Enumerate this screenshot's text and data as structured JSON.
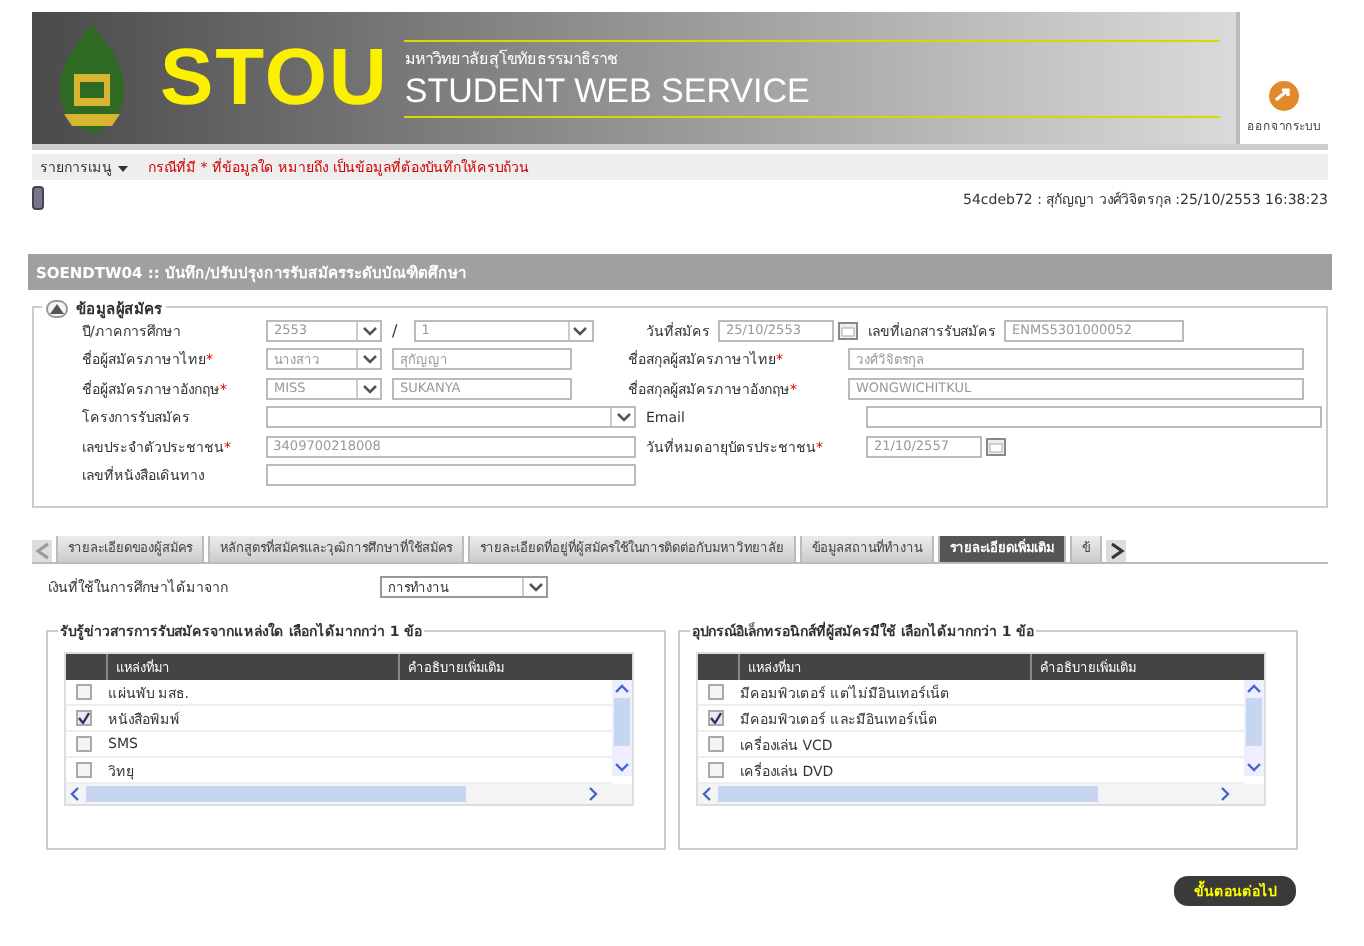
{
  "header": {
    "brand": "STOU",
    "university": "มหาวิทยาลัยสุโขทัยธรรมาธิราช",
    "service": "STUDENT WEB SERVICE",
    "logout": "ออกจากระบบ"
  },
  "menu_bar": {
    "menu": "รายการเมนู",
    "notice": "กรณีที่มี * ที่ข้อมูลใด หมายถึง เป็นข้อมูลที่ต้องบันทึกให้ครบถ้วน"
  },
  "status": "54cdeb72 : สุกัญญา วงศ์วิจิตรกุล :25/10/2553 16:38:23",
  "page_title": "SOENDTW04 :: บันทึก/ปรับปรุงการรับสมัครระดับบัณฑิตศึกษา",
  "section": {
    "title": "ข้อมูลผู้สมัคร",
    "expanded": true,
    "rows": [
      {
        "left": {
          "label": "ปี/ภาคการศึกษา",
          "controls": [
            {
              "kind": "select",
              "value": "2553",
              "disabled": true
            },
            {
              "kind": "sep",
              "value": "/"
            },
            {
              "kind": "select",
              "value": "1",
              "disabled": true
            }
          ]
        },
        "right": {
          "label": "วันที่สมัคร",
          "controls": [
            {
              "kind": "date",
              "value": "25/10/2553",
              "disabled": true
            },
            {
              "kind": "label",
              "value": "เลขที่เอกสารรับสมัคร"
            },
            {
              "kind": "text",
              "value": "ENMS5301000052",
              "disabled": true
            }
          ]
        }
      },
      {
        "left": {
          "label": "ชื่อผู้สมัครภาษาไทย",
          "mark": "*",
          "controls": [
            {
              "kind": "select",
              "value": "นางสาว",
              "disabled": true
            },
            {
              "kind": "text",
              "value": "สุกัญญา",
              "disabled": true
            }
          ]
        },
        "right": {
          "label": "ชื่อสกุลผู้สมัครภาษาไทย",
          "mark": "*",
          "controls": [
            {
              "kind": "text",
              "value": "วงศ์วิจิตรกุล",
              "disabled": true
            }
          ]
        }
      },
      {
        "left": {
          "label": "ชื่อผู้สมัครภาษาอังกฤษ",
          "mark": "*",
          "controls": [
            {
              "kind": "select",
              "value": "MISS",
              "disabled": true
            },
            {
              "kind": "text",
              "value": "SUKANYA",
              "disabled": true
            }
          ]
        },
        "right": {
          "label": "ชื่อสกุลผู้สมัครภาษาอังกฤษ",
          "mark": "*",
          "controls": [
            {
              "kind": "text",
              "value": "WONGWICHITKUL",
              "disabled": true
            }
          ]
        }
      },
      {
        "left": {
          "label": "โครงการรับสมัคร",
          "controls": [
            {
              "kind": "select"
            }
          ]
        },
        "right": {
          "label": "Email",
          "controls": [
            {
              "kind": "text"
            }
          ]
        }
      },
      {
        "left": {
          "label": "เลขประจำตัวประชาชน",
          "mark": "*",
          "controls": [
            {
              "kind": "text",
              "value": "3409700218008",
              "disabled": true
            }
          ]
        },
        "right": {
          "label": "วันที่หมดอายุบัตรประชาชน",
          "mark": "*",
          "controls": [
            {
              "kind": "date",
              "value": "21/10/2557",
              "disabled": true
            }
          ]
        }
      },
      {
        "left": {
          "label": "เลขที่หนังสือเดินทาง",
          "controls": [
            {
              "kind": "text"
            }
          ]
        }
      }
    ]
  },
  "tabs": [
    {
      "label": "รายละเอียดของผู้สมัคร",
      "selected": false
    },
    {
      "label": "หลักสูตรที่สมัครและวุฒิการศึกษาที่ใช้สมัคร",
      "selected": false
    },
    {
      "label": "รายละเอียดที่อยู่ที่ผู้สมัครใช้ในการติดต่อกับมหาวิทยาลัย",
      "selected": false
    },
    {
      "label": "ข้อมูลสถานที่ทำงาน",
      "selected": false
    },
    {
      "label": "รายละเอียดเพิ่มเติม",
      "selected": true
    },
    {
      "label": "ข้",
      "selected": false
    }
  ],
  "funding": {
    "label": "เงินที่ใช้ในการศึกษาได้มาจาก",
    "value": "การทำงาน"
  },
  "groups": [
    {
      "title": "รับรู้ข่าวสารการรับสมัครจากแหล่งใด เลือกได้มากกว่า 1 ข้อ",
      "columns": [
        "แหล่งที่มา",
        "คำอธิบายเพิ่มเติม"
      ],
      "rows": [
        {
          "label": "แผ่นพับ มสธ.",
          "checked": false
        },
        {
          "label": "หนังสือพิมพ์",
          "checked": true
        },
        {
          "label": "SMS",
          "checked": false
        },
        {
          "label": "วิทยุ",
          "checked": false
        }
      ]
    },
    {
      "title": "อุปกรณ์อิเล็กทรอนิกส์ที่ผู้สมัครมีใช้ เลือกได้มากกว่า 1 ข้อ",
      "columns": [
        "แหล่งที่มา",
        "คำอธิบายเพิ่มเติม"
      ],
      "rows": [
        {
          "label": "มีคอมพิวเตอร์ แต่ไม่มีอินเทอร์เน็ต",
          "checked": false
        },
        {
          "label": "มีคอมพิวเตอร์ และมีอินเทอร์เน็ต",
          "checked": true
        },
        {
          "label": "เครื่องเล่น VCD",
          "checked": false
        },
        {
          "label": "เครื่องเล่น DVD",
          "checked": false
        }
      ]
    }
  ],
  "next_button": "ขั้นตอนต่อไป"
}
